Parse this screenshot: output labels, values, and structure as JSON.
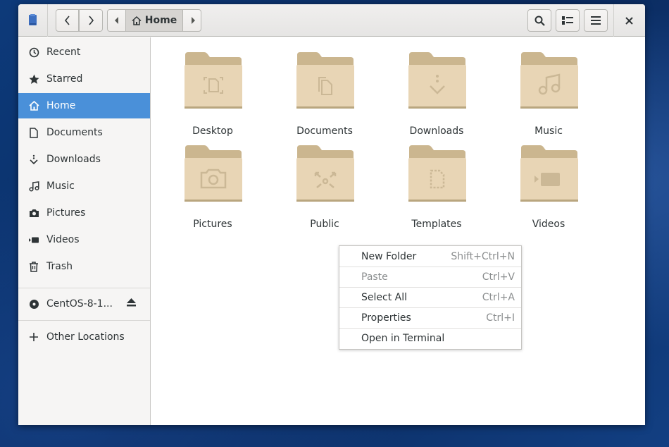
{
  "window": {
    "location": "Home"
  },
  "sidebar": {
    "items": [
      {
        "label": "Recent",
        "icon": "clock-icon"
      },
      {
        "label": "Starred",
        "icon": "star-icon"
      },
      {
        "label": "Home",
        "icon": "home-icon",
        "selected": true
      },
      {
        "label": "Documents",
        "icon": "document-icon"
      },
      {
        "label": "Downloads",
        "icon": "download-icon"
      },
      {
        "label": "Music",
        "icon": "music-icon"
      },
      {
        "label": "Pictures",
        "icon": "camera-icon"
      },
      {
        "label": "Videos",
        "icon": "video-icon"
      },
      {
        "label": "Trash",
        "icon": "trash-icon"
      }
    ],
    "device": {
      "label": "CentOS-8-1...",
      "icon": "disc-icon",
      "action_icon": "eject-icon"
    },
    "other": {
      "label": "Other Locations",
      "icon": "plus-icon"
    }
  },
  "folders": [
    {
      "label": "Desktop",
      "emblem": "desktop-emblem"
    },
    {
      "label": "Documents",
      "emblem": "documents-emblem"
    },
    {
      "label": "Downloads",
      "emblem": "downloads-emblem"
    },
    {
      "label": "Music",
      "emblem": "music-emblem"
    },
    {
      "label": "Pictures",
      "emblem": "camera-emblem"
    },
    {
      "label": "Public",
      "emblem": "share-emblem"
    },
    {
      "label": "Templates",
      "emblem": "template-emblem"
    },
    {
      "label": "Videos",
      "emblem": "video-emblem"
    }
  ],
  "context_menu": {
    "items": [
      {
        "label": "New Folder",
        "accel": "Shift+Ctrl+N",
        "enabled": true
      },
      {
        "label": "Paste",
        "accel": "Ctrl+V",
        "enabled": false
      },
      {
        "label": "Select All",
        "accel": "Ctrl+A",
        "enabled": true
      },
      {
        "label": "Properties",
        "accel": "Ctrl+I",
        "enabled": true
      },
      {
        "label": "Open in Terminal",
        "accel": "",
        "enabled": true
      }
    ]
  },
  "colors": {
    "accent": "#4a90d9",
    "folder": "#e8d5b5",
    "folder_tab": "#cbb68f"
  }
}
